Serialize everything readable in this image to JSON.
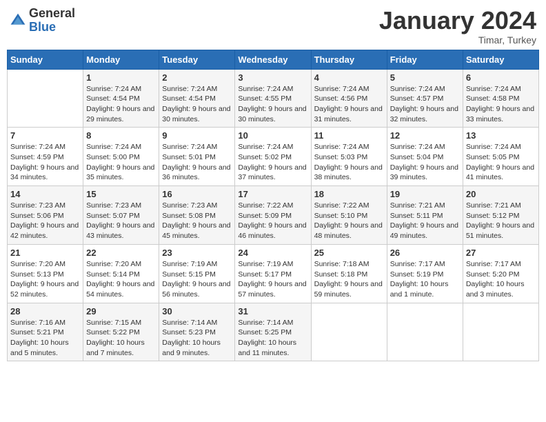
{
  "header": {
    "logo_general": "General",
    "logo_blue": "Blue",
    "month_title": "January 2024",
    "location": "Timar, Turkey"
  },
  "days_of_week": [
    "Sunday",
    "Monday",
    "Tuesday",
    "Wednesday",
    "Thursday",
    "Friday",
    "Saturday"
  ],
  "weeks": [
    [
      {
        "day": "",
        "sunrise": "",
        "sunset": "",
        "daylight": ""
      },
      {
        "day": "1",
        "sunrise": "Sunrise: 7:24 AM",
        "sunset": "Sunset: 4:54 PM",
        "daylight": "Daylight: 9 hours and 29 minutes."
      },
      {
        "day": "2",
        "sunrise": "Sunrise: 7:24 AM",
        "sunset": "Sunset: 4:54 PM",
        "daylight": "Daylight: 9 hours and 30 minutes."
      },
      {
        "day": "3",
        "sunrise": "Sunrise: 7:24 AM",
        "sunset": "Sunset: 4:55 PM",
        "daylight": "Daylight: 9 hours and 30 minutes."
      },
      {
        "day": "4",
        "sunrise": "Sunrise: 7:24 AM",
        "sunset": "Sunset: 4:56 PM",
        "daylight": "Daylight: 9 hours and 31 minutes."
      },
      {
        "day": "5",
        "sunrise": "Sunrise: 7:24 AM",
        "sunset": "Sunset: 4:57 PM",
        "daylight": "Daylight: 9 hours and 32 minutes."
      },
      {
        "day": "6",
        "sunrise": "Sunrise: 7:24 AM",
        "sunset": "Sunset: 4:58 PM",
        "daylight": "Daylight: 9 hours and 33 minutes."
      }
    ],
    [
      {
        "day": "7",
        "sunrise": "Sunrise: 7:24 AM",
        "sunset": "Sunset: 4:59 PM",
        "daylight": "Daylight: 9 hours and 34 minutes."
      },
      {
        "day": "8",
        "sunrise": "Sunrise: 7:24 AM",
        "sunset": "Sunset: 5:00 PM",
        "daylight": "Daylight: 9 hours and 35 minutes."
      },
      {
        "day": "9",
        "sunrise": "Sunrise: 7:24 AM",
        "sunset": "Sunset: 5:01 PM",
        "daylight": "Daylight: 9 hours and 36 minutes."
      },
      {
        "day": "10",
        "sunrise": "Sunrise: 7:24 AM",
        "sunset": "Sunset: 5:02 PM",
        "daylight": "Daylight: 9 hours and 37 minutes."
      },
      {
        "day": "11",
        "sunrise": "Sunrise: 7:24 AM",
        "sunset": "Sunset: 5:03 PM",
        "daylight": "Daylight: 9 hours and 38 minutes."
      },
      {
        "day": "12",
        "sunrise": "Sunrise: 7:24 AM",
        "sunset": "Sunset: 5:04 PM",
        "daylight": "Daylight: 9 hours and 39 minutes."
      },
      {
        "day": "13",
        "sunrise": "Sunrise: 7:24 AM",
        "sunset": "Sunset: 5:05 PM",
        "daylight": "Daylight: 9 hours and 41 minutes."
      }
    ],
    [
      {
        "day": "14",
        "sunrise": "Sunrise: 7:23 AM",
        "sunset": "Sunset: 5:06 PM",
        "daylight": "Daylight: 9 hours and 42 minutes."
      },
      {
        "day": "15",
        "sunrise": "Sunrise: 7:23 AM",
        "sunset": "Sunset: 5:07 PM",
        "daylight": "Daylight: 9 hours and 43 minutes."
      },
      {
        "day": "16",
        "sunrise": "Sunrise: 7:23 AM",
        "sunset": "Sunset: 5:08 PM",
        "daylight": "Daylight: 9 hours and 45 minutes."
      },
      {
        "day": "17",
        "sunrise": "Sunrise: 7:22 AM",
        "sunset": "Sunset: 5:09 PM",
        "daylight": "Daylight: 9 hours and 46 minutes."
      },
      {
        "day": "18",
        "sunrise": "Sunrise: 7:22 AM",
        "sunset": "Sunset: 5:10 PM",
        "daylight": "Daylight: 9 hours and 48 minutes."
      },
      {
        "day": "19",
        "sunrise": "Sunrise: 7:21 AM",
        "sunset": "Sunset: 5:11 PM",
        "daylight": "Daylight: 9 hours and 49 minutes."
      },
      {
        "day": "20",
        "sunrise": "Sunrise: 7:21 AM",
        "sunset": "Sunset: 5:12 PM",
        "daylight": "Daylight: 9 hours and 51 minutes."
      }
    ],
    [
      {
        "day": "21",
        "sunrise": "Sunrise: 7:20 AM",
        "sunset": "Sunset: 5:13 PM",
        "daylight": "Daylight: 9 hours and 52 minutes."
      },
      {
        "day": "22",
        "sunrise": "Sunrise: 7:20 AM",
        "sunset": "Sunset: 5:14 PM",
        "daylight": "Daylight: 9 hours and 54 minutes."
      },
      {
        "day": "23",
        "sunrise": "Sunrise: 7:19 AM",
        "sunset": "Sunset: 5:15 PM",
        "daylight": "Daylight: 9 hours and 56 minutes."
      },
      {
        "day": "24",
        "sunrise": "Sunrise: 7:19 AM",
        "sunset": "Sunset: 5:17 PM",
        "daylight": "Daylight: 9 hours and 57 minutes."
      },
      {
        "day": "25",
        "sunrise": "Sunrise: 7:18 AM",
        "sunset": "Sunset: 5:18 PM",
        "daylight": "Daylight: 9 hours and 59 minutes."
      },
      {
        "day": "26",
        "sunrise": "Sunrise: 7:17 AM",
        "sunset": "Sunset: 5:19 PM",
        "daylight": "Daylight: 10 hours and 1 minute."
      },
      {
        "day": "27",
        "sunrise": "Sunrise: 7:17 AM",
        "sunset": "Sunset: 5:20 PM",
        "daylight": "Daylight: 10 hours and 3 minutes."
      }
    ],
    [
      {
        "day": "28",
        "sunrise": "Sunrise: 7:16 AM",
        "sunset": "Sunset: 5:21 PM",
        "daylight": "Daylight: 10 hours and 5 minutes."
      },
      {
        "day": "29",
        "sunrise": "Sunrise: 7:15 AM",
        "sunset": "Sunset: 5:22 PM",
        "daylight": "Daylight: 10 hours and 7 minutes."
      },
      {
        "day": "30",
        "sunrise": "Sunrise: 7:14 AM",
        "sunset": "Sunset: 5:23 PM",
        "daylight": "Daylight: 10 hours and 9 minutes."
      },
      {
        "day": "31",
        "sunrise": "Sunrise: 7:14 AM",
        "sunset": "Sunset: 5:25 PM",
        "daylight": "Daylight: 10 hours and 11 minutes."
      },
      {
        "day": "",
        "sunrise": "",
        "sunset": "",
        "daylight": ""
      },
      {
        "day": "",
        "sunrise": "",
        "sunset": "",
        "daylight": ""
      },
      {
        "day": "",
        "sunrise": "",
        "sunset": "",
        "daylight": ""
      }
    ]
  ]
}
